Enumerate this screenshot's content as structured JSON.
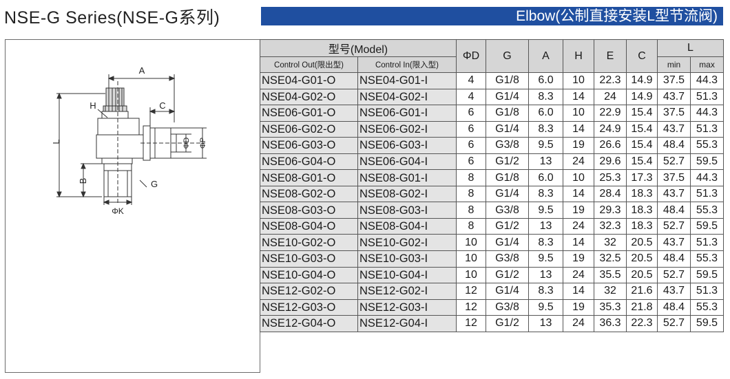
{
  "header": {
    "series_title": "NSE-G Series(NSE-G系列)",
    "bar_title": "Elbow(公制直接安装L型节流阀)",
    "bar_color": "#1f4fa0"
  },
  "diagram": {
    "labels": {
      "A": "A",
      "H": "H",
      "C": "C",
      "L": "L",
      "D": "ΦD",
      "P": "ΦP",
      "B": "B",
      "G": "G",
      "K": "ΦK"
    }
  },
  "table": {
    "headers": {
      "model": "型号(Model)",
      "control_out": "Control Out(限出型)",
      "control_in": "Control In(限入型)",
      "d": "ΦD",
      "g": "G",
      "a": "A",
      "h": "H",
      "e": "E",
      "c": "C",
      "l": "L",
      "l_min": "min",
      "l_max": "max"
    },
    "rows": [
      {
        "out": "NSE04-G01-O",
        "in": "NSE04-G01-I",
        "d": "4",
        "g": "G1/8",
        "a": "6.0",
        "h": "10",
        "e": "22.3",
        "c": "14.9",
        "lmin": "37.5",
        "lmax": "44.3"
      },
      {
        "out": "NSE04-G02-O",
        "in": "NSE04-G02-I",
        "d": "4",
        "g": "G1/4",
        "a": "8.3",
        "h": "14",
        "e": "24",
        "c": "14.9",
        "lmin": "43.7",
        "lmax": "51.3"
      },
      {
        "out": "NSE06-G01-O",
        "in": "NSE06-G01-I",
        "d": "6",
        "g": "G1/8",
        "a": "6.0",
        "h": "10",
        "e": "22.9",
        "c": "15.4",
        "lmin": "37.5",
        "lmax": "44.3"
      },
      {
        "out": "NSE06-G02-O",
        "in": "NSE06-G02-I",
        "d": "6",
        "g": "G1/4",
        "a": "8.3",
        "h": "14",
        "e": "24.9",
        "c": "15.4",
        "lmin": "43.7",
        "lmax": "51.3"
      },
      {
        "out": "NSE06-G03-O",
        "in": "NSE06-G03-I",
        "d": "6",
        "g": "G3/8",
        "a": "9.5",
        "h": "19",
        "e": "26.6",
        "c": "15.4",
        "lmin": "48.4",
        "lmax": "55.3"
      },
      {
        "out": "NSE06-G04-O",
        "in": "NSE06-G04-I",
        "d": "6",
        "g": "G1/2",
        "a": "13",
        "h": "24",
        "e": "29.6",
        "c": "15.4",
        "lmin": "52.7",
        "lmax": "59.5"
      },
      {
        "out": "NSE08-G01-O",
        "in": "NSE08-G01-I",
        "d": "8",
        "g": "G1/8",
        "a": "6.0",
        "h": "10",
        "e": "25.3",
        "c": "17.3",
        "lmin": "37.5",
        "lmax": "44.3"
      },
      {
        "out": "NSE08-G02-O",
        "in": "NSE08-G02-I",
        "d": "8",
        "g": "G1/4",
        "a": "8.3",
        "h": "14",
        "e": "28.4",
        "c": "18.3",
        "lmin": "43.7",
        "lmax": "51.3"
      },
      {
        "out": "NSE08-G03-O",
        "in": "NSE08-G03-I",
        "d": "8",
        "g": "G3/8",
        "a": "9.5",
        "h": "19",
        "e": "29.3",
        "c": "18.3",
        "lmin": "48.4",
        "lmax": "55.3"
      },
      {
        "out": "NSE08-G04-O",
        "in": "NSE08-G04-I",
        "d": "8",
        "g": "G1/2",
        "a": "13",
        "h": "24",
        "e": "32.3",
        "c": "18.3",
        "lmin": "52.7",
        "lmax": "59.5"
      },
      {
        "out": "NSE10-G02-O",
        "in": "NSE10-G02-I",
        "d": "10",
        "g": "G1/4",
        "a": "8.3",
        "h": "14",
        "e": "32",
        "c": "20.5",
        "lmin": "43.7",
        "lmax": "51.3"
      },
      {
        "out": "NSE10-G03-O",
        "in": "NSE10-G03-I",
        "d": "10",
        "g": "G3/8",
        "a": "9.5",
        "h": "19",
        "e": "32.5",
        "c": "20.5",
        "lmin": "48.4",
        "lmax": "55.3"
      },
      {
        "out": "NSE10-G04-O",
        "in": "NSE10-G04-I",
        "d": "10",
        "g": "G1/2",
        "a": "13",
        "h": "24",
        "e": "35.5",
        "c": "20.5",
        "lmin": "52.7",
        "lmax": "59.5"
      },
      {
        "out": "NSE12-G02-O",
        "in": "NSE12-G02-I",
        "d": "12",
        "g": "G1/4",
        "a": "8.3",
        "h": "14",
        "e": "32",
        "c": "21.6",
        "lmin": "43.7",
        "lmax": "51.3"
      },
      {
        "out": "NSE12-G03-O",
        "in": "NSE12-G03-I",
        "d": "12",
        "g": "G3/8",
        "a": "9.5",
        "h": "19",
        "e": "35.3",
        "c": "21.8",
        "lmin": "48.4",
        "lmax": "55.3"
      },
      {
        "out": "NSE12-G04-O",
        "in": "NSE12-G04-I",
        "d": "12",
        "g": "G1/2",
        "a": "13",
        "h": "24",
        "e": "36.3",
        "c": "22.3",
        "lmin": "52.7",
        "lmax": "59.5"
      }
    ]
  }
}
